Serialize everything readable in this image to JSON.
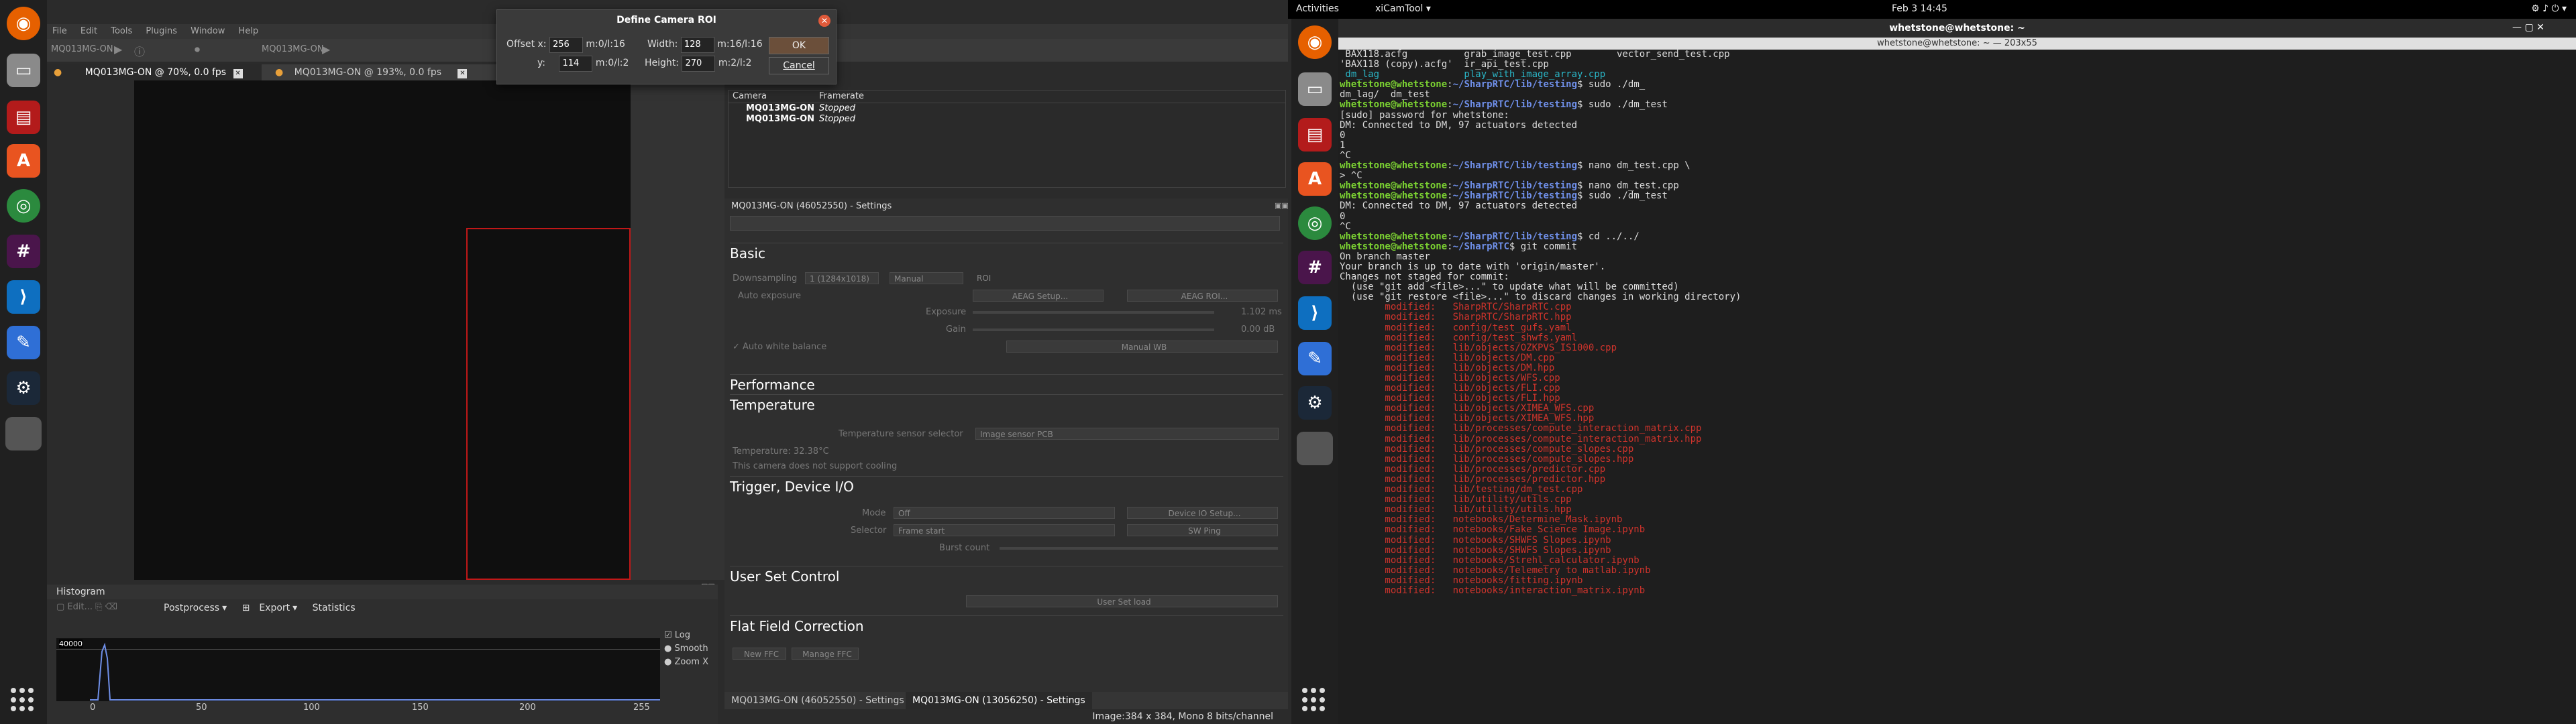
{
  "left_app": {
    "menu": [
      "File",
      "Edit",
      "Tools",
      "Plugins",
      "Window",
      "Help"
    ],
    "toolbar_camera": "MQ013MG-ON",
    "tabs": [
      "MQ013MG-ON @ 70%, 0.0 fps",
      "MQ013MG-ON @ 193%, 0.0 fps"
    ],
    "histogram": {
      "title": "Histogram",
      "tools": [
        "Postprocess",
        "Export",
        "Statistics"
      ],
      "value_label": "40000",
      "ticks": [
        "0",
        "50",
        "100",
        "150",
        "200",
        "255"
      ],
      "options": [
        "Log",
        "Smooth",
        "Zoom X"
      ]
    },
    "dialog": {
      "title": "Define Camera ROI",
      "offset_x_label": "Offset x:",
      "offset_x": "256",
      "offset_x_hint": "m:0/l:16",
      "y_label": "y:",
      "y": "114",
      "y_hint": "m:0/l:2",
      "width_label": "Width:",
      "width": "128",
      "width_hint": "m:16/l:16",
      "height_label": "Height:",
      "height": "270",
      "height_hint": "m:2/l:2",
      "ok": "OK",
      "cancel": "Cancel"
    },
    "camera_list": {
      "headers": [
        "Camera",
        "Framerate"
      ],
      "rows": [
        [
          "MQ013MG-ON",
          "Stopped"
        ],
        [
          "MQ013MG-ON",
          "Stopped"
        ]
      ]
    },
    "settings": {
      "title": "MQ013MG-ON (46052550) - Settings",
      "sections": [
        "Basic",
        "Performance",
        "Temperature",
        "Trigger, Device I/O",
        "User Set Control",
        "Flat Field Correction"
      ],
      "downsampling_label": "Downsampling",
      "downsampling": "1 (1284x1018)",
      "binning": "Manual",
      "roi": "ROI",
      "auto_exposure": "Auto exposure",
      "aeag_setup": "AEAG Setup...",
      "aeag_roi": "AEAG ROI...",
      "exposure_label": "Exposure",
      "exposure": "1.102 ms",
      "gain_label": "Gain",
      "gain": "0.00 dB",
      "awb": "Auto white balance",
      "manual_wb": "Manual WB",
      "temp_selector_label": "Temperature sensor selector",
      "temp_selector": "Image sensor PCB",
      "temperature": "Temperature: 32.38°C",
      "cooling": "This camera does not support cooling",
      "mode_label": "Mode",
      "mode": "Off",
      "device_io": "Device IO Setup...",
      "selector_label": "Selector",
      "selector": "Frame start",
      "sw_ping": "SW Ping",
      "burst_label": "Burst count",
      "user_set_load": "User Set load",
      "new_ffc": "New FFC",
      "manage_ffc": "Manage FFC"
    },
    "bottom_tabs": [
      "MQ013MG-ON (46052550) - Settings",
      "MQ013MG-ON (13056250) - Settings"
    ],
    "status": "Image:384 x 384, Mono 8 bits/channel"
  },
  "topbar": {
    "activities": "Activities",
    "app": "xiCamTool",
    "clock": "Feb 3  14:45"
  },
  "terminal": {
    "title": "whetstone@whetstone: ~",
    "subtitle": "whetstone@whetstone: ~ — 203x55",
    "lines": [
      {
        "t": " BAX118.acfg          grab_image_test.cpp        vector_send_test.cpp",
        "k": "n"
      },
      {
        "t": "'BAX118 (copy).acfg'  ir_api_test.cpp",
        "k": "n"
      },
      {
        "t": " dm_lag               play_with_image_array.cpp",
        "k": "c"
      },
      {
        "p": "~/SharpRTC/lib/testing",
        "cmd": " sudo ./dm_",
        "k": "p"
      },
      {
        "t": "dm_lag/  dm_test",
        "k": "n"
      },
      {
        "p": "~/SharpRTC/lib/testing",
        "cmd": " sudo ./dm_test",
        "k": "p"
      },
      {
        "t": "[sudo] password for whetstone:",
        "k": "n"
      },
      {
        "t": "DM: Connected to DM, 97 actuators detected",
        "k": "n"
      },
      {
        "t": "0",
        "k": "n"
      },
      {
        "t": "1",
        "k": "n"
      },
      {
        "t": "^C",
        "k": "n"
      },
      {
        "p": "~/SharpRTC/lib/testing",
        "cmd": " nano dm_test.cpp \\",
        "k": "p"
      },
      {
        "t": "> ^C",
        "k": "n"
      },
      {
        "p": "~/SharpRTC/lib/testing",
        "cmd": " nano dm_test.cpp",
        "k": "p"
      },
      {
        "p": "~/SharpRTC/lib/testing",
        "cmd": " sudo ./dm_test",
        "k": "p"
      },
      {
        "t": "DM: Connected to DM, 97 actuators detected",
        "k": "n"
      },
      {
        "t": "0",
        "k": "n"
      },
      {
        "t": "^C",
        "k": "n"
      },
      {
        "p": "~/SharpRTC/lib/testing",
        "cmd": " cd ../../",
        "k": "p"
      },
      {
        "p": "~/SharpRTC",
        "cmd": " git commit",
        "k": "p"
      },
      {
        "t": "On branch master",
        "k": "n"
      },
      {
        "t": "Your branch is up to date with 'origin/master'.",
        "k": "n"
      },
      {
        "t": "",
        "k": "n"
      },
      {
        "t": "Changes not staged for commit:",
        "k": "n"
      },
      {
        "t": "  (use \"git add <file>...\" to update what will be committed)",
        "k": "n"
      },
      {
        "t": "  (use \"git restore <file>...\" to discard changes in working directory)",
        "k": "n"
      },
      {
        "t": "        modified:   SharpRTC/SharpRTC.cpp",
        "k": "r"
      },
      {
        "t": "        modified:   SharpRTC/SharpRTC.hpp",
        "k": "r"
      },
      {
        "t": "        modified:   config/test_gufs.yaml",
        "k": "r"
      },
      {
        "t": "        modified:   config/test_shwfs.yaml",
        "k": "r"
      },
      {
        "t": "        modified:   lib/objects/OZKPVS_IS1000.cpp",
        "k": "r"
      },
      {
        "t": "        modified:   lib/objects/DM.cpp",
        "k": "r"
      },
      {
        "t": "        modified:   lib/objects/DM.hpp",
        "k": "r"
      },
      {
        "t": "        modified:   lib/objects/WFS.cpp",
        "k": "r"
      },
      {
        "t": "        modified:   lib/objects/FLI.cpp",
        "k": "r"
      },
      {
        "t": "        modified:   lib/objects/FLI.hpp",
        "k": "r"
      },
      {
        "t": "        modified:   lib/objects/XIMEA_WFS.cpp",
        "k": "r"
      },
      {
        "t": "        modified:   lib/objects/XIMEA_WFS.hpp",
        "k": "r"
      },
      {
        "t": "        modified:   lib/processes/compute_interaction_matrix.cpp",
        "k": "r"
      },
      {
        "t": "        modified:   lib/processes/compute_interaction_matrix.hpp",
        "k": "r"
      },
      {
        "t": "        modified:   lib/processes/compute_slopes.cpp",
        "k": "r"
      },
      {
        "t": "        modified:   lib/processes/compute_slopes.hpp",
        "k": "r"
      },
      {
        "t": "        modified:   lib/processes/predictor.cpp",
        "k": "r"
      },
      {
        "t": "        modified:   lib/processes/predictor.hpp",
        "k": "r"
      },
      {
        "t": "        modified:   lib/testing/dm_test.cpp",
        "k": "r"
      },
      {
        "t": "        modified:   lib/utility/utils.cpp",
        "k": "r"
      },
      {
        "t": "        modified:   lib/utility/utils.hpp",
        "k": "r"
      },
      {
        "t": "        modified:   notebooks/Determine_Mask.ipynb",
        "k": "r"
      },
      {
        "t": "        modified:   notebooks/Fake Science Image.ipynb",
        "k": "r"
      },
      {
        "t": "        modified:   notebooks/SHWFS Slopes.ipynb",
        "k": "r"
      },
      {
        "t": "        modified:   notebooks/SHWFS Slopes.ipynb",
        "k": "r"
      },
      {
        "t": "        modified:   notebooks/Strehl_calculator.ipynb",
        "k": "r"
      },
      {
        "t": "        modified:   notebooks/Telemetry to matlab.ipynb",
        "k": "r"
      },
      {
        "t": "        modified:   notebooks/fitting.ipynb",
        "k": "r"
      },
      {
        "t": "        modified:   notebooks/interaction_matrix.ipynb",
        "k": "r"
      }
    ]
  },
  "colors": {
    "terminal_bg": "#1e1e1e",
    "prompt_user": "#7cd332",
    "prompt_path": "#6f8fe8",
    "modified": "#d0342c",
    "roi_box": "#c01818"
  },
  "dock_left": [
    "firefox-icon",
    "files-icon",
    "terminal-app-icon",
    "software-icon",
    "chrome-icon",
    "slack-icon",
    "vscode-icon",
    "editor-icon",
    "steam-icon",
    "active-app-icon"
  ],
  "dock_right": [
    "firefox-icon",
    "files-icon",
    "terminal-app-icon",
    "software-icon",
    "chrome-icon",
    "slack-icon",
    "vscode-icon",
    "editor-icon",
    "steam-icon",
    "active-app-icon"
  ]
}
